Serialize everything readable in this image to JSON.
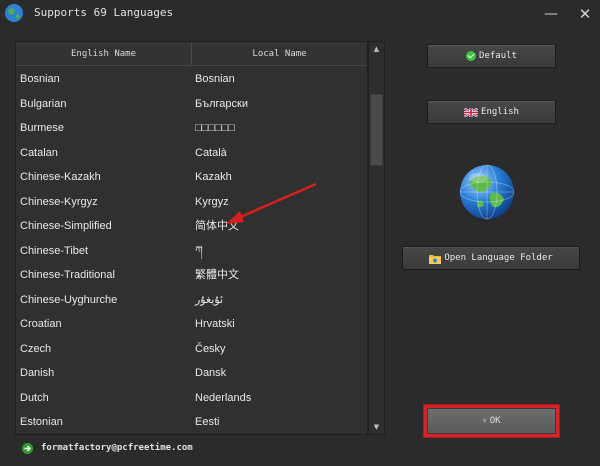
{
  "window": {
    "title": "Supports 69 Languages",
    "minimize_glyph": "—",
    "close_glyph": "✕"
  },
  "list": {
    "columns": [
      "English Name",
      "Local Name"
    ],
    "rows": [
      {
        "english": "Bosnian",
        "local": "Bosnian"
      },
      {
        "english": "Bulgarian",
        "local": "Български"
      },
      {
        "english": "Burmese",
        "local": "□□□□□□"
      },
      {
        "english": "Catalan",
        "local": "Català"
      },
      {
        "english": "Chinese-Kazakh",
        "local": "Kazakh"
      },
      {
        "english": "Chinese-Kyrgyz",
        "local": "Kyrgyz"
      },
      {
        "english": "Chinese-Simplified",
        "local": "简体中文"
      },
      {
        "english": "Chinese-Tibet",
        "local": "ཀ"
      },
      {
        "english": "Chinese-Traditional",
        "local": "繁體中文"
      },
      {
        "english": "Chinese-Uyghurche",
        "local": "ئۇيغۇر"
      },
      {
        "english": "Croatian",
        "local": "Hrvatski"
      },
      {
        "english": "Czech",
        "local": "Česky"
      },
      {
        "english": "Danish",
        "local": "Dansk"
      },
      {
        "english": "Dutch",
        "local": "Nederlands"
      },
      {
        "english": "Estonian",
        "local": "Eesti"
      }
    ]
  },
  "buttons": {
    "default_label": "Default",
    "english_label": "English",
    "folder_label": "Open Language Folder",
    "ok_label": "OK"
  },
  "footer": {
    "email": "formatfactory@pcfreetime.com"
  },
  "colors": {
    "background": "#2b2b2b",
    "highlight_red": "#d6232a",
    "arrow_red": "#d62020"
  }
}
